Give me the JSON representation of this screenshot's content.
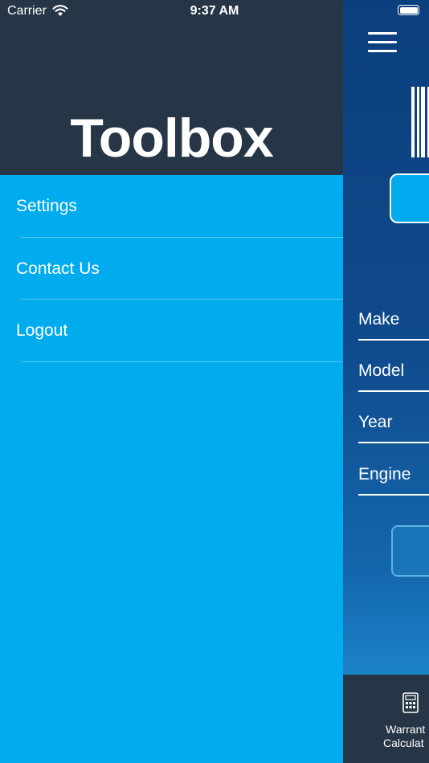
{
  "status_bar": {
    "carrier": "Carrier",
    "time": "9:37 AM"
  },
  "drawer": {
    "title": "Toolbox",
    "items": [
      {
        "label": "Settings"
      },
      {
        "label": "Contact Us"
      },
      {
        "label": "Logout"
      }
    ]
  },
  "main": {
    "fields": [
      {
        "label": "Make"
      },
      {
        "label": "Model"
      },
      {
        "label": "Year"
      },
      {
        "label": "Engine"
      }
    ],
    "tabbar": {
      "tab_line1": "Warrant",
      "tab_line2": "Calculat",
      "icon": "calculator-icon"
    }
  },
  "colors": {
    "drawer_bg": "#00abee",
    "header_bg": "#263646",
    "main_bg": "#0f4a8c"
  }
}
